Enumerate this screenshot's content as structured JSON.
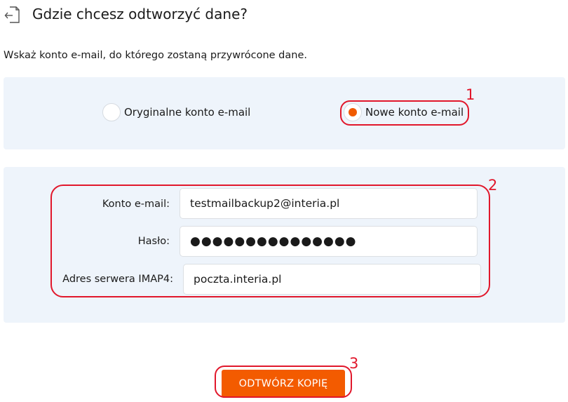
{
  "header": {
    "title": "Gdzie chcesz odtworzyć dane?",
    "icon": "restore-icon"
  },
  "subtitle": "Wskaż konto e-mail, do którego zostaną przywrócone dane.",
  "destination": {
    "options": [
      {
        "label": "Oryginalne konto e-mail",
        "selected": false
      },
      {
        "label": "Nowe konto e-mail",
        "selected": true
      }
    ]
  },
  "form": {
    "email_label": "Konto e-mail:",
    "email_value": "testmailbackup2@interia.pl",
    "password_label": "Hasło:",
    "password_value": "●●●●●●●●●●●●●●●",
    "imap_label": "Adres serwera IMAP4:",
    "imap_value": "poczta.interia.pl"
  },
  "actions": {
    "restore_label": "ODTWÓRZ KOPIĘ"
  },
  "annotations": {
    "n1": "1",
    "n2": "2",
    "n3": "3"
  },
  "colors": {
    "accent": "#f35b00",
    "panel": "#eef4fb",
    "annotation": "#e1172b"
  }
}
